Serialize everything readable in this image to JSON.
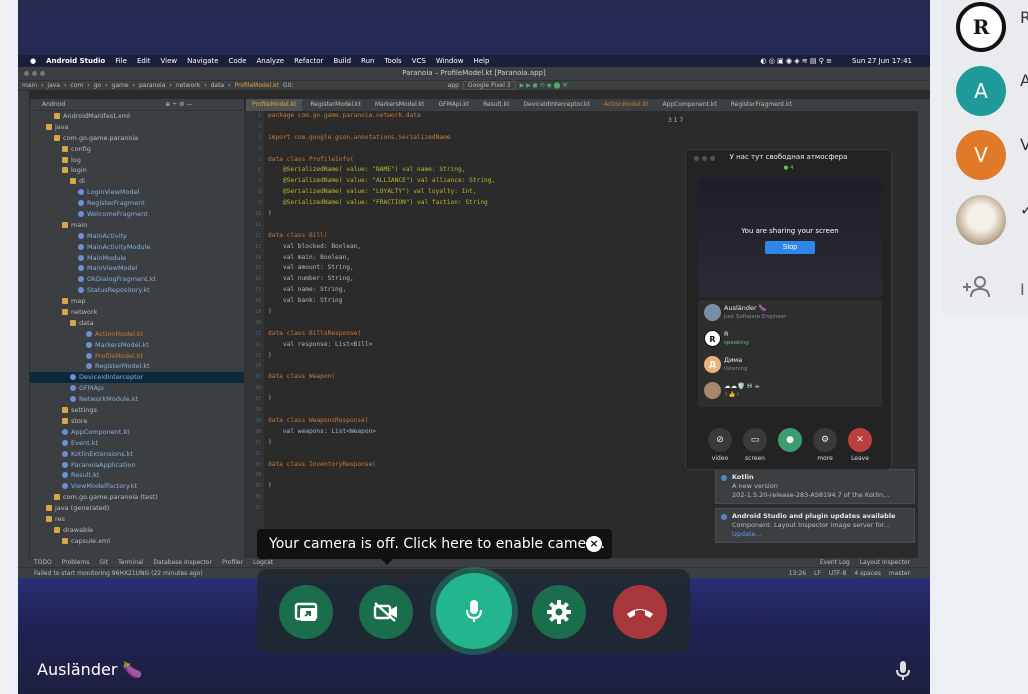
{
  "mac_menu": {
    "items": [
      "Android Studio",
      "File",
      "Edit",
      "View",
      "Navigate",
      "Code",
      "Analyze",
      "Refactor",
      "Build",
      "Run",
      "Tools",
      "VCS",
      "Window",
      "Help"
    ],
    "clock": "Sun 27 Jun  17:41"
  },
  "ide": {
    "window_title": "Paranoia – ProfileModel.kt [Paranoia.app]",
    "breadcrumb": [
      "main",
      "java",
      "com",
      "go",
      "game",
      "paranoia",
      "network",
      "data",
      "ProfileModel.kt",
      "Git:"
    ],
    "run_config": "app",
    "device": "Google Pixel 3",
    "tabs": [
      "ProfileModel.kt",
      "RegisterModel.kt",
      "MarkersModel.kt",
      "GFMApi.kt",
      "Result.kt",
      "DeviceIdInterceptor.kt",
      "ActionModel.kt",
      "AppComponent.kt",
      "RegisterFragment.kt"
    ],
    "project_view": "Android",
    "tree": [
      {
        "label": "AndroidManifest.xml",
        "indent": 3,
        "type": "file"
      },
      {
        "label": "java",
        "indent": 2,
        "type": "folder"
      },
      {
        "label": "com.go.game.paranoia",
        "indent": 3,
        "type": "folder"
      },
      {
        "label": "config",
        "indent": 4,
        "type": "folder"
      },
      {
        "label": "log",
        "indent": 4,
        "type": "folder"
      },
      {
        "label": "login",
        "indent": 4,
        "type": "folder"
      },
      {
        "label": "di",
        "indent": 5,
        "type": "folder"
      },
      {
        "label": "LoginViewModel",
        "indent": 6,
        "type": "kt"
      },
      {
        "label": "RegisterFragment",
        "indent": 6,
        "type": "kt"
      },
      {
        "label": "WelcomeFragment",
        "indent": 6,
        "type": "kt"
      },
      {
        "label": "main",
        "indent": 4,
        "type": "folder"
      },
      {
        "label": "MainActivity",
        "indent": 6,
        "type": "kt"
      },
      {
        "label": "MainActivityModule",
        "indent": 6,
        "type": "kt"
      },
      {
        "label": "MainModule",
        "indent": 6,
        "type": "kt"
      },
      {
        "label": "MainViewModel",
        "indent": 6,
        "type": "kt"
      },
      {
        "label": "OkDialogFragment.kt",
        "indent": 6,
        "type": "kt"
      },
      {
        "label": "StatusRepository.kt",
        "indent": 6,
        "type": "kt"
      },
      {
        "label": "map",
        "indent": 4,
        "type": "folder"
      },
      {
        "label": "network",
        "indent": 4,
        "type": "folder"
      },
      {
        "label": "data",
        "indent": 5,
        "type": "folder"
      },
      {
        "label": "ActionModel.kt",
        "indent": 7,
        "type": "hl"
      },
      {
        "label": "MarkersModel.kt",
        "indent": 7,
        "type": "kt"
      },
      {
        "label": "ProfileModel.kt",
        "indent": 7,
        "type": "hl"
      },
      {
        "label": "RegisterModel.kt",
        "indent": 7,
        "type": "kt"
      },
      {
        "label": "DeviceIdInterceptor",
        "indent": 5,
        "type": "sel"
      },
      {
        "label": "GFMApi",
        "indent": 5,
        "type": "kt"
      },
      {
        "label": "NetworkModule.kt",
        "indent": 5,
        "type": "kt"
      },
      {
        "label": "settings",
        "indent": 4,
        "type": "folder"
      },
      {
        "label": "store",
        "indent": 4,
        "type": "folder"
      },
      {
        "label": "AppComponent.kt",
        "indent": 4,
        "type": "kt"
      },
      {
        "label": "Event.kt",
        "indent": 4,
        "type": "kt"
      },
      {
        "label": "KotlinExtensions.kt",
        "indent": 4,
        "type": "kt"
      },
      {
        "label": "ParanoiaApplication",
        "indent": 4,
        "type": "kt"
      },
      {
        "label": "Result.kt",
        "indent": 4,
        "type": "kt"
      },
      {
        "label": "ViewModelFactory.kt",
        "indent": 4,
        "type": "kt"
      },
      {
        "label": "com.go.game.paranoia (test)",
        "indent": 3,
        "type": "folder"
      },
      {
        "label": "java (generated)",
        "indent": 2,
        "type": "folder"
      },
      {
        "label": "res",
        "indent": 2,
        "type": "folder"
      },
      {
        "label": "drawable",
        "indent": 3,
        "type": "folder"
      },
      {
        "label": "capsule.xml",
        "indent": 4,
        "type": "file"
      }
    ],
    "line_numbers": [
      "1",
      "2",
      "3",
      "4",
      "5",
      "6",
      "7",
      "8",
      "9",
      "10",
      "11",
      "12",
      "13",
      "14",
      "15",
      "16",
      "17",
      "18",
      "19",
      "20",
      "21",
      "22",
      "23",
      "24",
      "25",
      "26",
      "27",
      "28",
      "29",
      "30",
      "31",
      "32",
      "33",
      "34",
      "35",
      "36",
      "37"
    ],
    "code_lines": [
      "package com.go.game.paranoia.network.data",
      "",
      "import com.google.gson.annotations.SerializedName",
      "",
      "data class ProfileInfo(",
      "    @SerializedName( value: \"NAME\") val name: String,",
      "    @SerializedName( value: \"ALLIANCE\") val alliance: String,",
      "    @SerializedName( value: \"LOYALTY\") val loyalty: Int,",
      "    @SerializedName( value: \"FRACTION\") val faction: String",
      ")",
      "",
      "data class Bill(",
      "    val blocked: Boolean,",
      "    val main: Boolean,",
      "    val amount: String,",
      "    val number: String,",
      "    val name: String,",
      "    val bank: String",
      ")",
      "",
      "data class BillsResponse(",
      "    val response: List<Bill>",
      ")",
      "",
      "data class Weapon(",
      "",
      ")",
      "",
      "data class WeaponsResponse(",
      "    val weapons: List<Weapon>",
      ")",
      "",
      "data class InventoryResponse(",
      "",
      ")",
      "",
      ""
    ],
    "bottom_tools": [
      "TODO",
      "Problems",
      "Git",
      "Terminal",
      "Database Inspector",
      "Profiler",
      "Logcat"
    ],
    "status_text": "Failed to start monitoring 96HX21UNG (22 minutes ago)",
    "status_right": [
      "13:26",
      "LF",
      "UTF-8",
      "4 spaces",
      "master"
    ],
    "event_log": "Event Log",
    "layout_inspector": "Layout Inspector",
    "inspection": "3  1  7"
  },
  "notifications": [
    {
      "title": "Kotlin",
      "lines": [
        "A new version",
        "202-1.5.20-release-283-AS8194.7 of the Kotlin..."
      ]
    },
    {
      "title": "Android Studio and plugin updates available",
      "lines": [
        "Component: Layout Inspector image server for..."
      ],
      "link": "Update..."
    }
  ],
  "call_window": {
    "title": "У нас тут свободная атмосфера",
    "count": "4",
    "sharing_text": "You are sharing your screen",
    "stop_label": "Stop",
    "participants": [
      {
        "name": "Ausländer 🍆",
        "status": "Just Software Engineer",
        "avatar": "",
        "speaking": false
      },
      {
        "name": "R",
        "status": "speaking",
        "avatar": "R",
        "speaking": true
      },
      {
        "name": "Дима",
        "status": "listening",
        "avatar": "Д",
        "speaking": false
      },
      {
        "name": "☁☁🛡️ H ☕",
        "status": "✌👍✌",
        "avatar": "",
        "speaking": false
      }
    ],
    "controls": [
      {
        "label": "video",
        "icon": "camera-off-icon"
      },
      {
        "label": "screen",
        "icon": "screen-share-icon"
      },
      {
        "label": "",
        "icon": "mic-icon"
      },
      {
        "label": "more",
        "icon": "gear-icon"
      },
      {
        "label": "Leave",
        "icon": "close-icon"
      }
    ]
  },
  "tooltip": {
    "text": "Your camera is off. Click here to enable camera."
  },
  "controls": {
    "screen_share": "screen-share-icon",
    "camera": "camera-off-icon",
    "mic": "mic-icon",
    "settings": "gear-icon",
    "leave": "phone-hangup-icon"
  },
  "speaker": {
    "name": "Ausländer 🍆"
  },
  "sidebar": {
    "participants": [
      {
        "avatar": "R",
        "color": "#ffffff",
        "cut": "R"
      },
      {
        "avatar": "A",
        "color": "#1e9a9a",
        "cut": "A"
      },
      {
        "avatar": "V",
        "color": "#e07a28",
        "cut": "V"
      },
      {
        "avatar": "",
        "color": "#c9b9a4",
        "cut": "✓"
      }
    ],
    "add_label": "I"
  },
  "colors": {
    "accent_green": "#23b58b",
    "button_green": "#1b6e4b",
    "leave_red": "#a8373c",
    "stage_bg": "#20234a"
  }
}
